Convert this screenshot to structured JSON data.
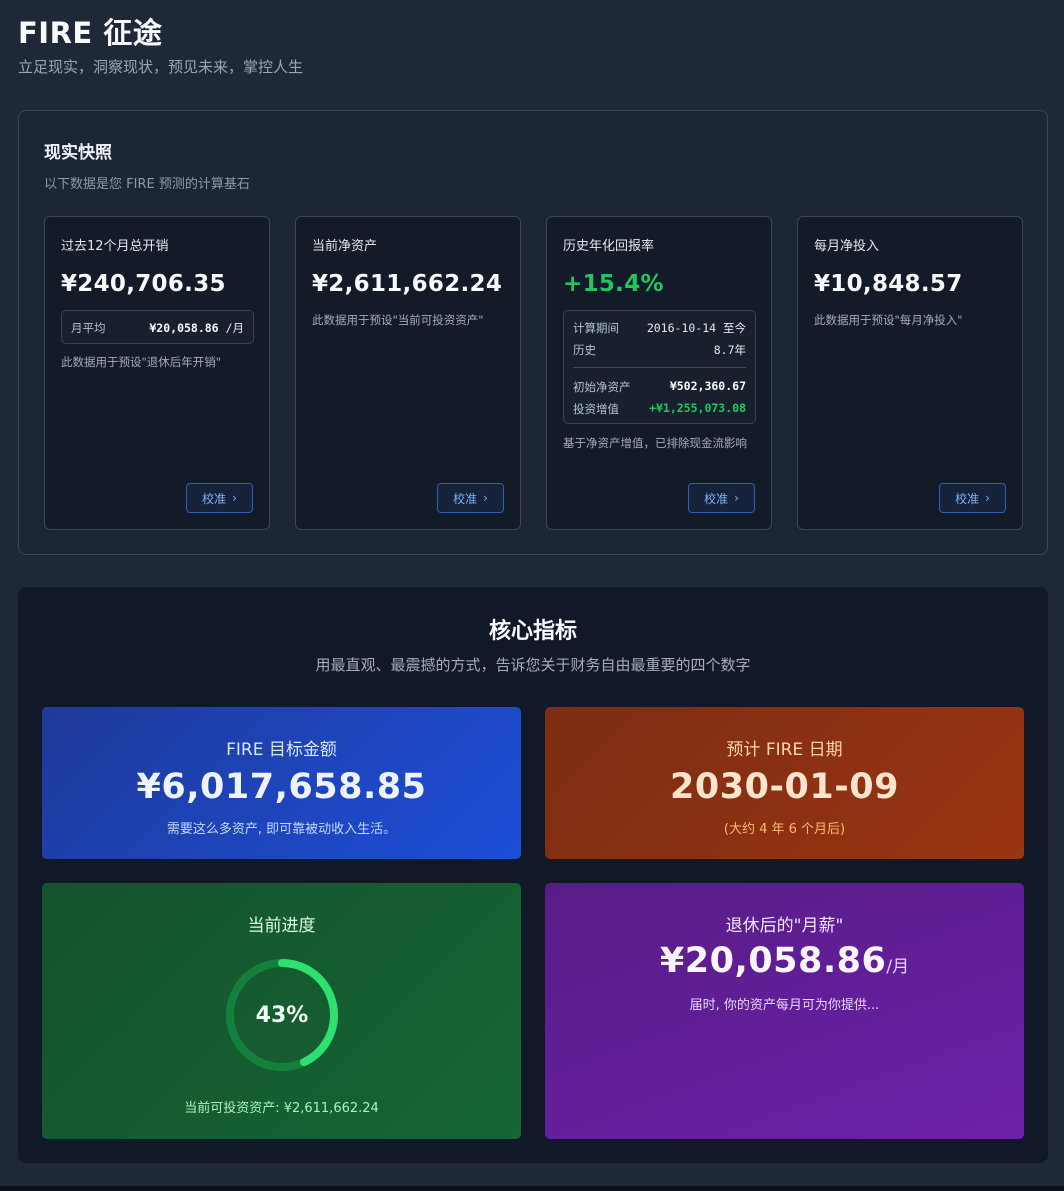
{
  "header": {
    "title": "FIRE 征途",
    "subtitle": "立足现实，洞察现状，预见未来，掌控人生"
  },
  "snapshot": {
    "title": "现实快照",
    "description": "以下数据是您 FIRE 预测的计算基石",
    "calibrate_label": "校准",
    "cards": [
      {
        "label": "过去12个月总开销",
        "value": "¥240,706.35",
        "avg_label": "月平均",
        "avg_value": "¥20,058.86",
        "avg_unit": "/月",
        "note": "此数据用于预设\"退休后年开销\""
      },
      {
        "label": "当前净资产",
        "value": "¥2,611,662.24",
        "note": "此数据用于预设\"当前可投资资产\""
      },
      {
        "label": "历史年化回报率",
        "value": "+15.4%",
        "period_label": "计算期间",
        "period_value": "2016-10-14 至今",
        "history_label": "历史",
        "history_value": "8.7年",
        "initial_label": "初始净资产",
        "initial_value": "¥502,360.67",
        "growth_label": "投资增值",
        "growth_value": "+¥1,255,073.08",
        "note": "基于净资产增值，已排除现金流影响"
      },
      {
        "label": "每月净投入",
        "value": "¥10,848.57",
        "note": "此数据用于预设\"每月净投入\""
      }
    ]
  },
  "core": {
    "title": "核心指标",
    "description": "用最直观、最震撼的方式，告诉您关于财务自由最重要的四个数字",
    "target": {
      "label": "FIRE 目标金额",
      "value": "¥6,017,658.85",
      "sub": "需要这么多资产, 即可靠被动收入生活。"
    },
    "date": {
      "label": "预计 FIRE 日期",
      "value": "2030-01-09",
      "sub": "(大约 4 年 6 个月后)"
    },
    "progress": {
      "label": "当前进度",
      "percent": 43,
      "percent_text": "43%",
      "sub": "当前可投资资产: ¥2,611,662.24"
    },
    "salary": {
      "label": "退休后的\"月薪\"",
      "value": "¥20,058.86",
      "unit": "/月",
      "sub": "届时, 你的资产每月可为你提供..."
    }
  },
  "colors": {
    "accent": "#3b82f6",
    "positive": "#22c55e",
    "ring_track": "#15803d",
    "ring_fill": "#2ee06f"
  }
}
